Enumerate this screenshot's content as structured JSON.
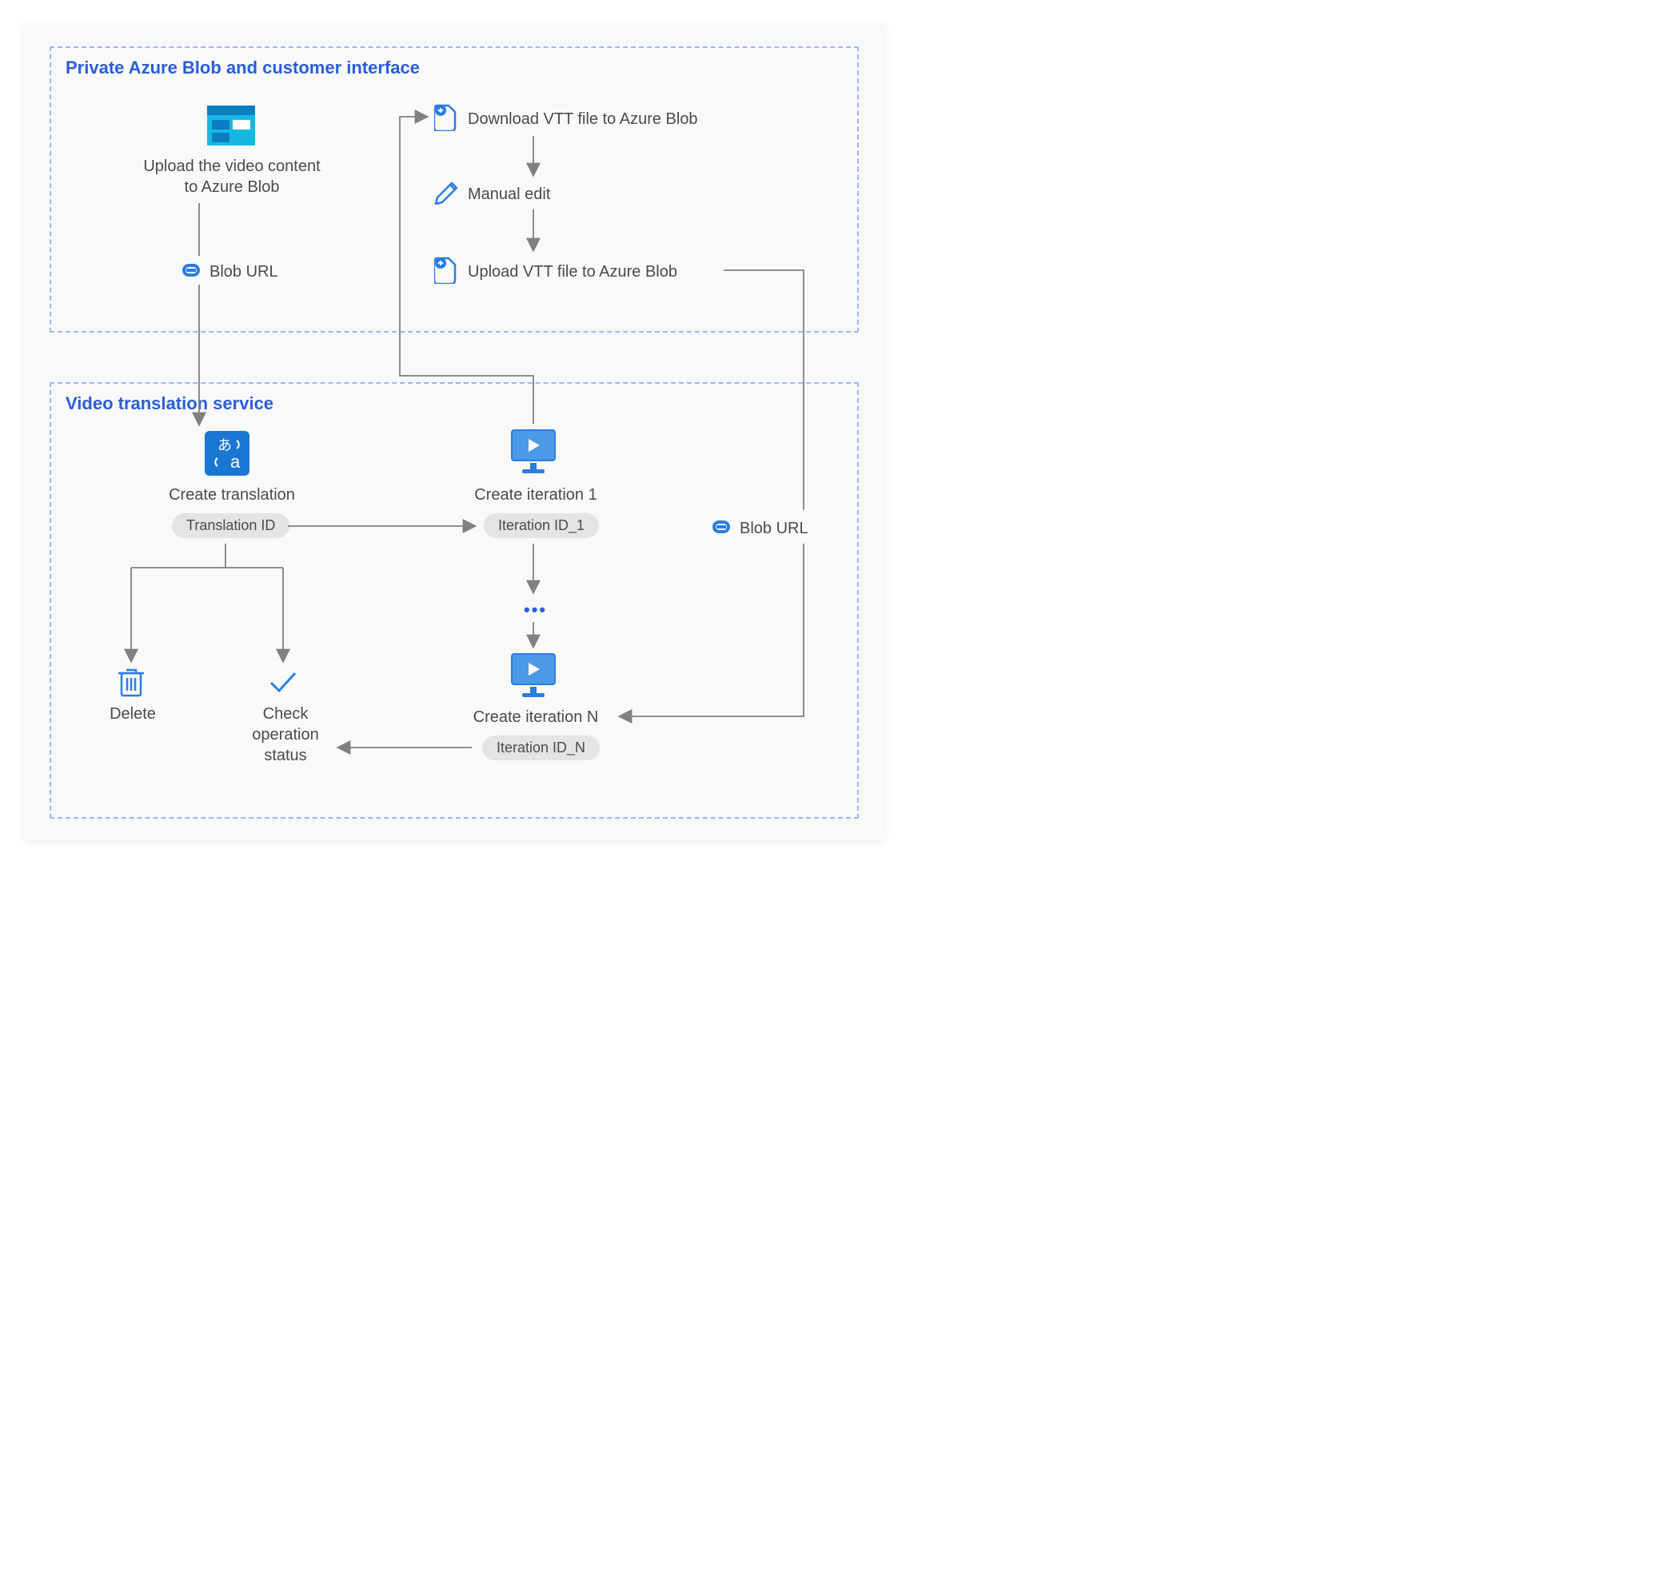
{
  "region1": {
    "title": "Private Azure Blob and customer interface"
  },
  "region2": {
    "title": "Video translation service"
  },
  "nodes": {
    "upload_video": "Upload the video content to Azure Blob",
    "blob_url_1": "Blob URL",
    "download_vtt": "Download VTT file to Azure Blob",
    "manual_edit": "Manual edit",
    "upload_vtt": "Upload VTT file to Azure Blob",
    "create_translation": "Create translation",
    "translation_id": "Translation ID",
    "delete": "Delete",
    "check_status": "Check operation status",
    "create_iter1": "Create iteration 1",
    "iter_id1": "Iteration ID_1",
    "create_iterN": "Create iteration N",
    "iter_idN": "Iteration ID_N",
    "blob_url_2": "Blob URL"
  }
}
